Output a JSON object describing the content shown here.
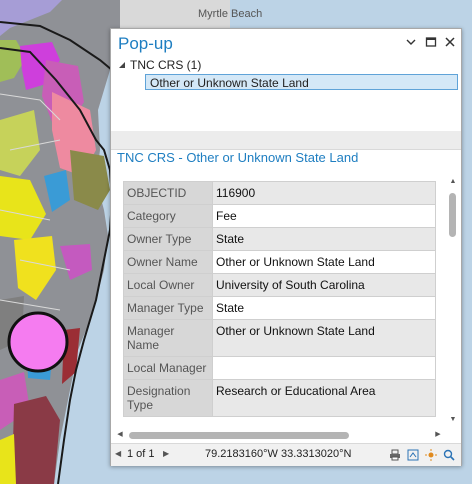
{
  "map": {
    "place_label": "Myrtle Beach",
    "icons": [
      "highlight-circle-icon"
    ]
  },
  "popup": {
    "title": "Pop-up",
    "header_icons": [
      "chevron-down-icon",
      "maximize-icon",
      "close-icon"
    ],
    "tree": {
      "root_label": "TNC CRS  (1)",
      "selected_item": "Other or Unknown State Land"
    },
    "detail_title": "TNC CRS - Other or Unknown State Land",
    "attributes": [
      {
        "key": "OBJECTID",
        "value": "116900"
      },
      {
        "key": "Category",
        "value": "Fee"
      },
      {
        "key": "Owner Type",
        "value": "State"
      },
      {
        "key": "Owner Name",
        "value": "Other or Unknown State Land"
      },
      {
        "key": "Local Owner",
        "value": "University of South Carolina"
      },
      {
        "key": "Manager Type",
        "value": "State"
      },
      {
        "key": "Manager Name",
        "value": "Other or Unknown State Land"
      },
      {
        "key": "Local Manager",
        "value": ""
      },
      {
        "key": "Designation Type",
        "value": "Research or Educational Area"
      }
    ],
    "status": {
      "page_text": "1 of 1",
      "coordinates": "79.2183160°W 33.3313020°N",
      "tool_icons": [
        "print-icon",
        "export-icon",
        "flash-icon",
        "zoom-to-icon"
      ]
    },
    "colors": {
      "accent": "#1e7ec1",
      "selection": "#d4e8f7"
    }
  }
}
